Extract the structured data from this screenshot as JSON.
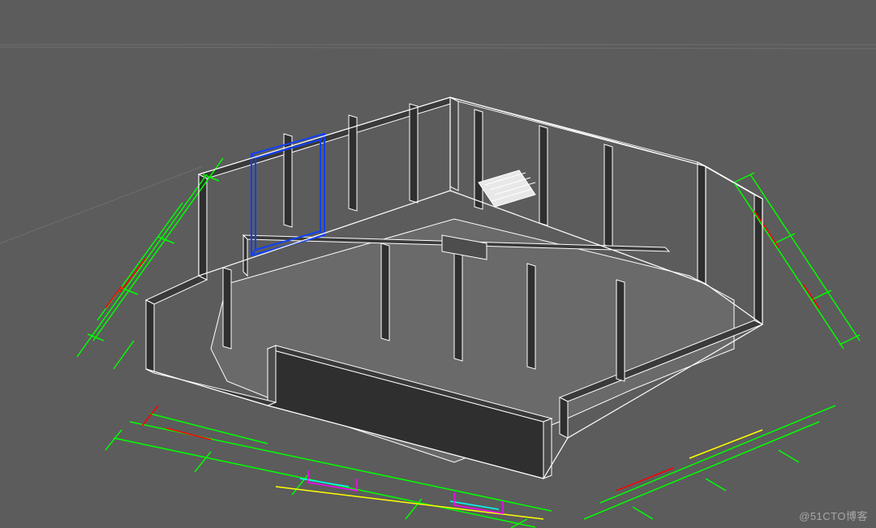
{
  "watermark": "@51CTO博客",
  "colors": {
    "bg": "#5c5c5c",
    "wall_dark": "#3a3a3a",
    "wall_darker": "#2f2f2f",
    "wall_light": "#4a4a4a",
    "floor": "#6a6a6a",
    "edge": "#ffffff",
    "dim_green": "#00ff00",
    "dim_red": "#ff0000",
    "dim_yellow": "#ffff00",
    "dim_cyan": "#00ffff",
    "dim_magenta": "#ff00ff",
    "sel_blue": "#1040ff"
  },
  "description": "3D isometric view of an extruded architectural floor plan inside a CAD-style modeling application. Walls are dark grey solids with white wireframe edges. A rectangular object on the left is selected (blue bounding outline). Dimension lines in green, red, yellow, cyan and magenta surround the model on the ground plane."
}
